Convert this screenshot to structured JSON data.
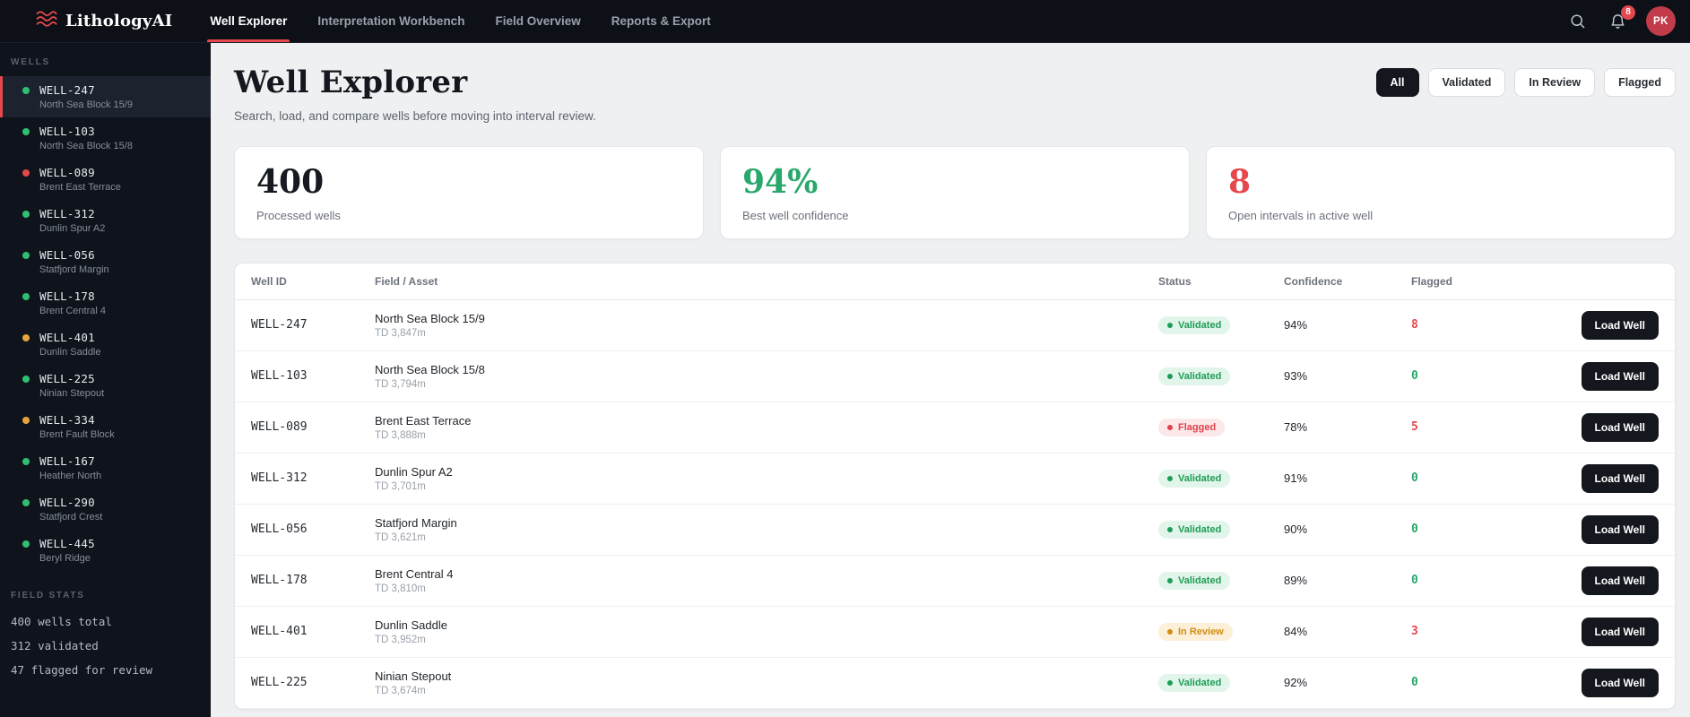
{
  "colors": {
    "accent": "#e5484d",
    "green": "#28a86b",
    "amber": "#d28d12",
    "dark": "#14171d"
  },
  "brand": {
    "name": "LithologyAI"
  },
  "nav": {
    "items": [
      {
        "label": "Well Explorer",
        "state": "active"
      },
      {
        "label": "Interpretation Workbench",
        "state": ""
      },
      {
        "label": "Field Overview",
        "state": ""
      },
      {
        "label": "Reports & Export",
        "state": ""
      }
    ],
    "notification_count": "8",
    "avatar_initials": "PK"
  },
  "sidebar": {
    "section_label": "WELLS",
    "wells": [
      {
        "id": "WELL-247",
        "field": "North Sea Block 15/9",
        "dot": "green",
        "state": "active"
      },
      {
        "id": "WELL-103",
        "field": "North Sea Block 15/8",
        "dot": "green",
        "state": ""
      },
      {
        "id": "WELL-089",
        "field": "Brent East Terrace",
        "dot": "red",
        "state": ""
      },
      {
        "id": "WELL-312",
        "field": "Dunlin Spur A2",
        "dot": "green",
        "state": ""
      },
      {
        "id": "WELL-056",
        "field": "Statfjord Margin",
        "dot": "green",
        "state": ""
      },
      {
        "id": "WELL-178",
        "field": "Brent Central 4",
        "dot": "green",
        "state": ""
      },
      {
        "id": "WELL-401",
        "field": "Dunlin Saddle",
        "dot": "orange",
        "state": ""
      },
      {
        "id": "WELL-225",
        "field": "Ninian Stepout",
        "dot": "green",
        "state": ""
      },
      {
        "id": "WELL-334",
        "field": "Brent Fault Block",
        "dot": "orange",
        "state": ""
      },
      {
        "id": "WELL-167",
        "field": "Heather North",
        "dot": "green",
        "state": ""
      },
      {
        "id": "WELL-290",
        "field": "Statfjord Crest",
        "dot": "green",
        "state": ""
      },
      {
        "id": "WELL-445",
        "field": "Beryl Ridge",
        "dot": "green",
        "state": ""
      }
    ],
    "stats_label": "FIELD STATS",
    "stats": [
      "400 wells total",
      "312 validated",
      "47 flagged for review"
    ]
  },
  "header": {
    "title": "Well Explorer",
    "subtitle": "Search, load, and compare wells before moving into interval review.",
    "filters": [
      {
        "label": "All",
        "state": "active"
      },
      {
        "label": "Validated",
        "state": ""
      },
      {
        "label": "In Review",
        "state": ""
      },
      {
        "label": "Flagged",
        "state": ""
      }
    ]
  },
  "stat_cards": [
    {
      "value": "400",
      "label": "Processed wells",
      "tone": "dark"
    },
    {
      "value": "94%",
      "label": "Best well confidence",
      "tone": "green"
    },
    {
      "value": "8",
      "label": "Open intervals in active well",
      "tone": "red"
    }
  ],
  "table": {
    "columns": [
      "Well ID",
      "Field / Asset",
      "Status",
      "Confidence",
      "Flagged",
      ""
    ],
    "load_button_label": "Load Well",
    "rows": [
      {
        "well_id": "WELL-247",
        "field": "North Sea Block 15/9",
        "td": "TD 3,847m",
        "status": "Validated",
        "status_type": "validated",
        "confidence": "94%",
        "flagged": "8",
        "flag_tone": "red"
      },
      {
        "well_id": "WELL-103",
        "field": "North Sea Block 15/8",
        "td": "TD 3,794m",
        "status": "Validated",
        "status_type": "validated",
        "confidence": "93%",
        "flagged": "0",
        "flag_tone": "green"
      },
      {
        "well_id": "WELL-089",
        "field": "Brent East Terrace",
        "td": "TD 3,888m",
        "status": "Flagged",
        "status_type": "flagged",
        "confidence": "78%",
        "flagged": "5",
        "flag_tone": "red"
      },
      {
        "well_id": "WELL-312",
        "field": "Dunlin Spur A2",
        "td": "TD 3,701m",
        "status": "Validated",
        "status_type": "validated",
        "confidence": "91%",
        "flagged": "0",
        "flag_tone": "green"
      },
      {
        "well_id": "WELL-056",
        "field": "Statfjord Margin",
        "td": "TD 3,621m",
        "status": "Validated",
        "status_type": "validated",
        "confidence": "90%",
        "flagged": "0",
        "flag_tone": "green"
      },
      {
        "well_id": "WELL-178",
        "field": "Brent Central 4",
        "td": "TD 3,810m",
        "status": "Validated",
        "status_type": "validated",
        "confidence": "89%",
        "flagged": "0",
        "flag_tone": "green"
      },
      {
        "well_id": "WELL-401",
        "field": "Dunlin Saddle",
        "td": "TD 3,952m",
        "status": "In Review",
        "status_type": "review",
        "confidence": "84%",
        "flagged": "3",
        "flag_tone": "red"
      },
      {
        "well_id": "WELL-225",
        "field": "Ninian Stepout",
        "td": "TD 3,674m",
        "status": "Validated",
        "status_type": "validated",
        "confidence": "92%",
        "flagged": "0",
        "flag_tone": "green"
      }
    ]
  }
}
